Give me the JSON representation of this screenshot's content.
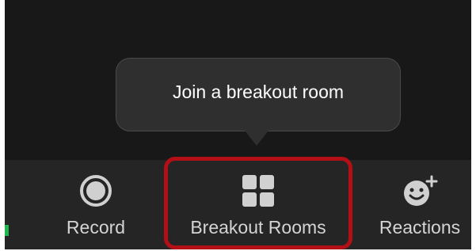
{
  "tooltip": {
    "text": "Join a breakout room"
  },
  "toolbar": {
    "record_label": "Record",
    "breakout_rooms_label": "Breakout Rooms",
    "reactions_label": "Reactions"
  },
  "icons": {
    "record": "record-icon",
    "breakout_rooms": "breakout-rooms-icon",
    "reactions": "add-reaction-icon"
  },
  "colors": {
    "background": "#181818",
    "toolbar": "#252525",
    "tooltip": "#2f2f2f",
    "highlight": "#b30f17",
    "label_text": "#d4d4d4",
    "active_indicator": "#1fb84f"
  }
}
